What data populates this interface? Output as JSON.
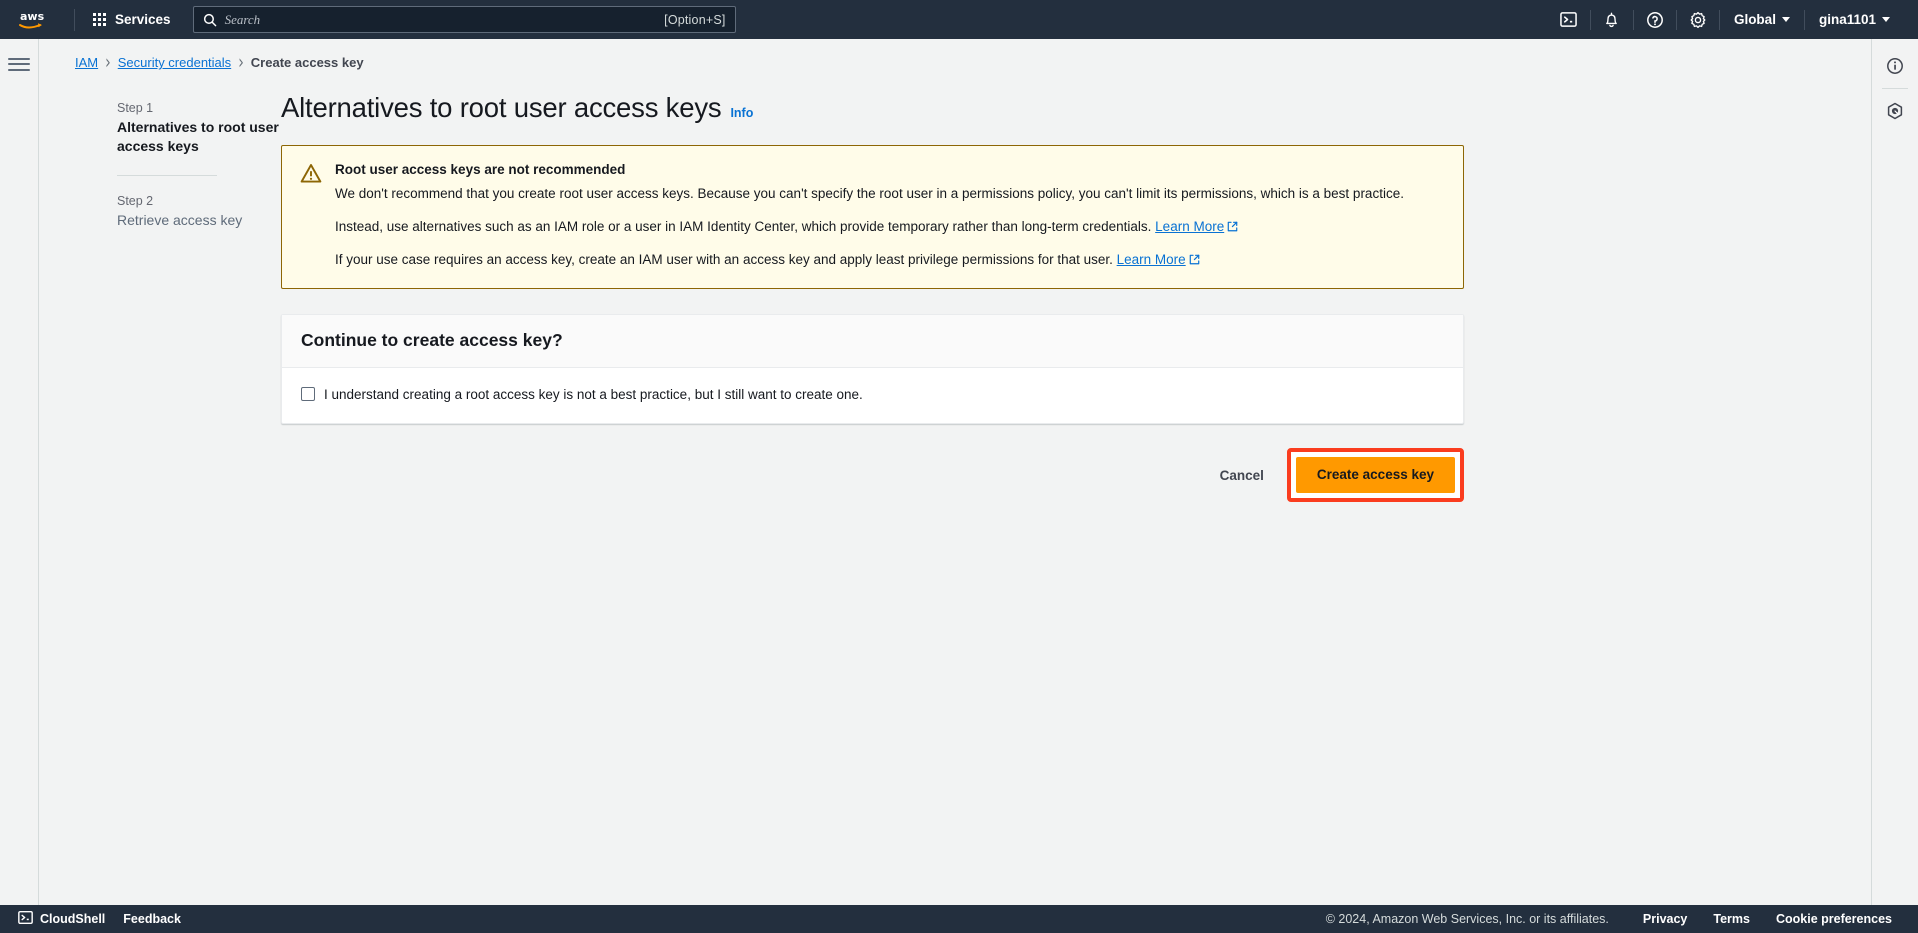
{
  "topnav": {
    "logo_alt": "aws",
    "services_label": "Services",
    "search": {
      "placeholder": "Search",
      "value": "",
      "shortcut": "[Option+S]"
    },
    "icons": [
      {
        "name": "cloudshell-icon",
        "label": "CloudShell"
      },
      {
        "name": "notifications-icon",
        "label": "Notifications"
      },
      {
        "name": "help-icon",
        "label": "Help"
      },
      {
        "name": "settings-icon",
        "label": "Settings"
      }
    ],
    "region_label": "Global",
    "account_label": "gina1101"
  },
  "breadcrumb": {
    "items": [
      {
        "label": "IAM",
        "link": true
      },
      {
        "label": "Security credentials",
        "link": true
      },
      {
        "label": "Create access key",
        "link": false
      }
    ],
    "separator": "›"
  },
  "steps": [
    {
      "step_label": "Step 1",
      "title": "Alternatives to root user access keys",
      "active": true
    },
    {
      "step_label": "Step 2",
      "title": "Retrieve access key",
      "active": false
    }
  ],
  "page": {
    "title": "Alternatives to root user access keys",
    "info_label": "Info"
  },
  "alert": {
    "type": "warning",
    "icon": "warning-triangle-icon",
    "title": "Root user access keys are not recommended",
    "paragraphs": [
      {
        "text": "We don't recommend that you create root user access keys. Because you can't specify the root user in a permissions policy, you can't limit its permissions, which is a best practice.",
        "link": null
      },
      {
        "text": "Instead, use alternatives such as an IAM role or a user in IAM Identity Center, which provide temporary rather than long-term credentials.",
        "link": "Learn More"
      },
      {
        "text": "If your use case requires an access key, create an IAM user with an access key and apply least privilege permissions for that user.",
        "link": "Learn More"
      }
    ]
  },
  "continue_panel": {
    "header": "Continue to create access key?",
    "checkbox": {
      "label": "I understand creating a root access key is not a best practice, but I still want to create one.",
      "checked": false
    }
  },
  "actions": {
    "cancel_label": "Cancel",
    "primary_label": "Create access key",
    "primary_highlighted": true
  },
  "right_rail": [
    {
      "name": "info-panel-icon"
    },
    {
      "name": "shortcuts-panel-icon"
    }
  ],
  "footer": {
    "cloudshell_label": "CloudShell",
    "feedback_label": "Feedback",
    "copyright": "© 2024, Amazon Web Services, Inc. or its affiliates.",
    "links": [
      "Privacy",
      "Terms",
      "Cookie preferences"
    ]
  },
  "colors": {
    "nav_bg": "#232f3e",
    "accent_orange": "#ff9900",
    "link_blue": "#0972d3",
    "warning_bg": "#fffce9",
    "warning_border": "#8d6605",
    "highlight_red": "#fa3c1e",
    "page_bg": "#f2f3f3"
  }
}
